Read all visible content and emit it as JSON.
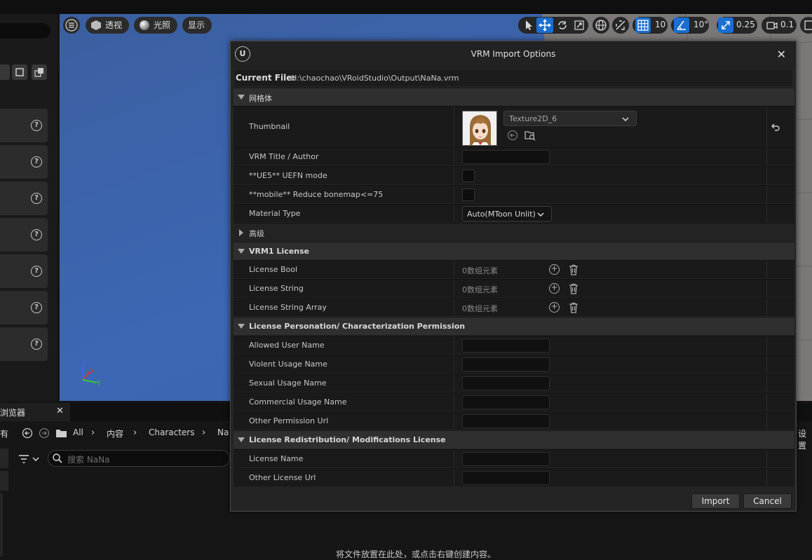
{
  "viewport": {
    "menu_icon": "hamburger-icon",
    "perspective_label": "透视",
    "lit_label": "光照",
    "show_label": "显示",
    "grid_value": "10",
    "angle_value": "10°",
    "scale_value": "0.25",
    "camera_value": "0.1",
    "axis_labels": {
      "z": "Z",
      "x": "X",
      "y": "Y"
    }
  },
  "content_browser": {
    "tab_label": "浏览器",
    "all_label": "有",
    "breadcrumb": [
      "All",
      "内容",
      "Characters",
      "Na"
    ],
    "settings_label": "设置",
    "search_placeholder": "搜索 NaNa",
    "drop_hint": "将文件放置在此处，或点击右键创建内容。"
  },
  "dialog": {
    "title": "VRM Import Options",
    "current_file_label": "Current File:",
    "current_file_path": "H:\\chaochao\\VRoidStudio\\Output\\NaNa.vrm",
    "mesh_category": "网格体",
    "thumbnail_label": "Thumbnail",
    "texture_value": "Texture2D_6",
    "vrm_title_label": "VRM Title / Author",
    "uefn_label": "**UE5** UEFN mode",
    "mobile_label": "**mobile** Reduce bonemap<=75",
    "material_type_label": "Material Type",
    "material_type_value": "Auto(MToon Unlit)",
    "advanced_label": "高级",
    "vrm1_license_label": "VRM1 License",
    "license_bool_label": "License Bool",
    "license_string_label": "License String",
    "license_string_array_label": "License String Array",
    "array_elements": "0数组元素",
    "personation_label": "License Personation/ Characterization Permission",
    "allowed_user_label": "Allowed User Name",
    "violent_label": "Violent Usage Name",
    "sexual_label": "Sexual Usage Name",
    "commercial_label": "Commercial Usage Name",
    "other_permission_label": "Other Permission Url",
    "redistribution_label": "License Redistribution/ Modifications License",
    "license_name_label": "License Name",
    "other_license_label": "Other License Url",
    "import_label": "Import",
    "cancel_label": "Cancel"
  }
}
